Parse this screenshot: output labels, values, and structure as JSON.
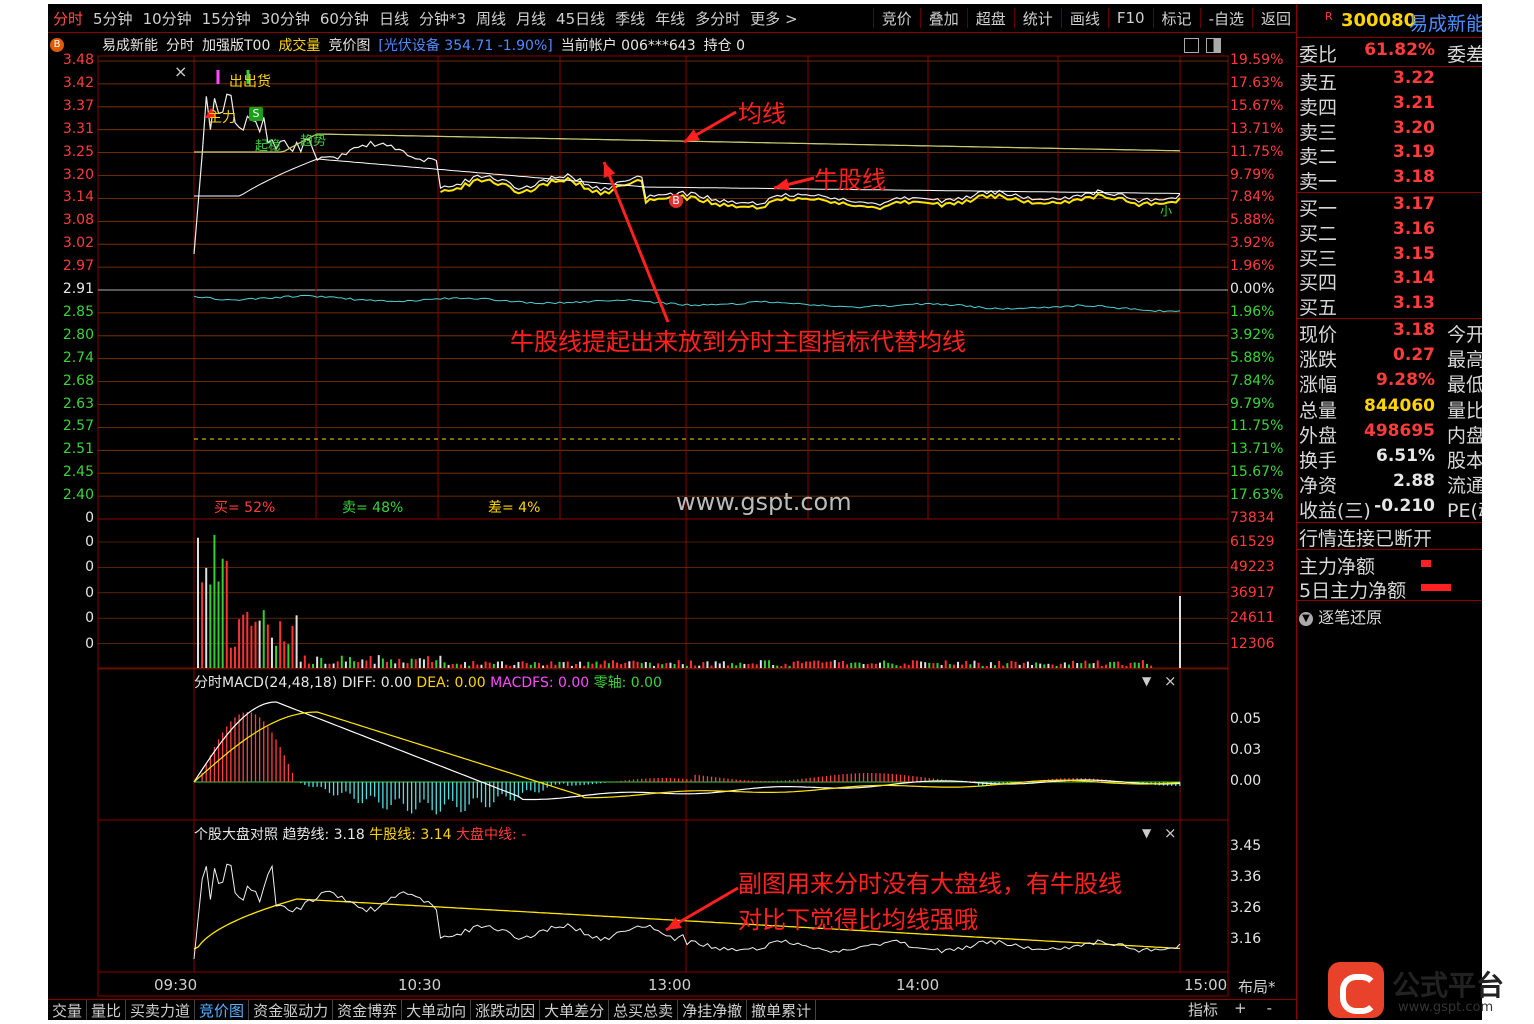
{
  "toolbar": {
    "left_tabs": [
      "分时",
      "5分钟",
      "10分钟",
      "15分钟",
      "30分钟",
      "60分钟",
      "日线",
      "分钟*3",
      "周线",
      "月线",
      "45日线",
      "季线",
      "年线",
      "多分时",
      "更多 >"
    ],
    "right_tabs": [
      "竞价",
      "叠加",
      "超盘",
      "统计",
      "画线",
      "F10",
      "标记",
      "-自选",
      "返回"
    ]
  },
  "info": {
    "badge": "B",
    "stock_name": "易成新能",
    "mode": "分时",
    "indicator": "加强版T00",
    "volume_label": "成交量",
    "auction_label": "竞价图",
    "sector": "[光伏设备 354.71 -1.90%]",
    "account": "当前帐户 006***643",
    "position": "持仓 0"
  },
  "price_axis": [
    "3.48",
    "3.42",
    "3.37",
    "3.31",
    "3.25",
    "3.20",
    "3.14",
    "3.08",
    "3.02",
    "2.97",
    "2.91",
    "2.85",
    "2.80",
    "2.74",
    "2.68",
    "2.63",
    "2.57",
    "2.51",
    "2.45",
    "2.40",
    "0"
  ],
  "pct_axis": [
    "19.59%",
    "17.63%",
    "15.67%",
    "13.71%",
    "11.75%",
    "9.79%",
    "7.84%",
    "5.88%",
    "3.92%",
    "1.96%",
    "0.00%",
    "1.96%",
    "3.92%",
    "5.88%",
    "7.84%",
    "9.79%",
    "11.75%",
    "13.71%",
    "15.67%",
    "17.63%",
    "73834"
  ],
  "volume_left_axis": [
    "0",
    "0",
    "0",
    "0",
    "0"
  ],
  "volume_right_axis": [
    "61529",
    "49223",
    "36917",
    "24611",
    "12306"
  ],
  "time_axis": [
    "09:30",
    "10:30",
    "13:00",
    "14:00",
    "15:00"
  ],
  "chart_labels": {
    "buy_signal": "出货",
    "buy_signal_prefix": "出",
    "main_force": "主力",
    "s_mark": "S",
    "b_mark": "B",
    "trend_label": "趋势",
    "accel_label": "起稳",
    "small_label": "小"
  },
  "ratio": {
    "buy": "买= 52%",
    "sell": "卖= 48%",
    "diff": "差= 4%"
  },
  "watermark": "www.gspt.com",
  "macd": {
    "title": "分时MACD(24,48,18)",
    "diff": "DIFF: 0.00",
    "dea": "DEA: 0.00",
    "macdfs": "MACDFS: 0.00",
    "zero": "零轴: 0.00",
    "axis": [
      "0.05",
      "0.03",
      "0.00"
    ]
  },
  "compare": {
    "title": "个股大盘对照",
    "trend": "趋势线: 3.18",
    "bull": "牛股线: 3.14",
    "index_mid": "大盘中线: -",
    "axis": [
      "3.45",
      "3.36",
      "3.26",
      "3.16"
    ]
  },
  "annotations": {
    "avg_line": "均线",
    "bull_line": "牛股线",
    "main_note": "牛股线提起出来放到分时主图指标代替均线",
    "sub_note_1": "副图用来分时没有大盘线，有牛股线",
    "sub_note_2": "对比下觉得比均线强哦"
  },
  "right_panel": {
    "code": "300080",
    "name": "易成新能",
    "market_tag": "R",
    "ratio_label": "委比",
    "ratio_value": "61.82%",
    "ratio_ext": "委差",
    "sells": [
      [
        "卖五",
        "3.22"
      ],
      [
        "卖四",
        "3.21"
      ],
      [
        "卖三",
        "3.20"
      ],
      [
        "卖二",
        "3.19"
      ],
      [
        "卖一",
        "3.18"
      ]
    ],
    "buys": [
      [
        "买一",
        "3.17"
      ],
      [
        "买二",
        "3.16"
      ],
      [
        "买三",
        "3.15"
      ],
      [
        "买四",
        "3.14"
      ],
      [
        "买五",
        "3.13"
      ]
    ],
    "stats": [
      {
        "label": "现价",
        "value": "3.18",
        "ext": "今开",
        "color": "#ff3b3b"
      },
      {
        "label": "涨跌",
        "value": "0.27",
        "ext": "最高",
        "color": "#ff3b3b"
      },
      {
        "label": "涨幅",
        "value": "9.28%",
        "ext": "最低",
        "color": "#ff3b3b"
      },
      {
        "label": "总量",
        "value": "844060",
        "ext": "量比",
        "color": "#ffd400"
      },
      {
        "label": "外盘",
        "value": "498695",
        "ext": "内盘",
        "color": "#ff3b3b"
      },
      {
        "label": "换手",
        "value": "6.51%",
        "ext": "股本",
        "color": "#e6e6e6"
      },
      {
        "label": "净资",
        "value": "2.88",
        "ext": "流通",
        "color": "#e6e6e6"
      },
      {
        "label": "收益(三)",
        "value": "-0.210",
        "ext": "PE(动",
        "color": "#e6e6e6"
      }
    ],
    "status": "行情连接已断开",
    "main_net": "主力净额",
    "main_net_5": "5日主力净额",
    "replay": "逐笔还原"
  },
  "bottom_tabs": [
    "交量",
    "量比",
    "买卖力道",
    "竞价图",
    "资金驱动力",
    "资金博弈",
    "大单动向",
    "涨跌动因",
    "大单差分",
    "总买总卖",
    "净挂净撤",
    "撤单累计"
  ],
  "bottom_right": [
    "指标",
    "+",
    "-",
    "布局"
  ],
  "logo": {
    "title": "公式平台",
    "url": "www.gspt.com"
  }
}
